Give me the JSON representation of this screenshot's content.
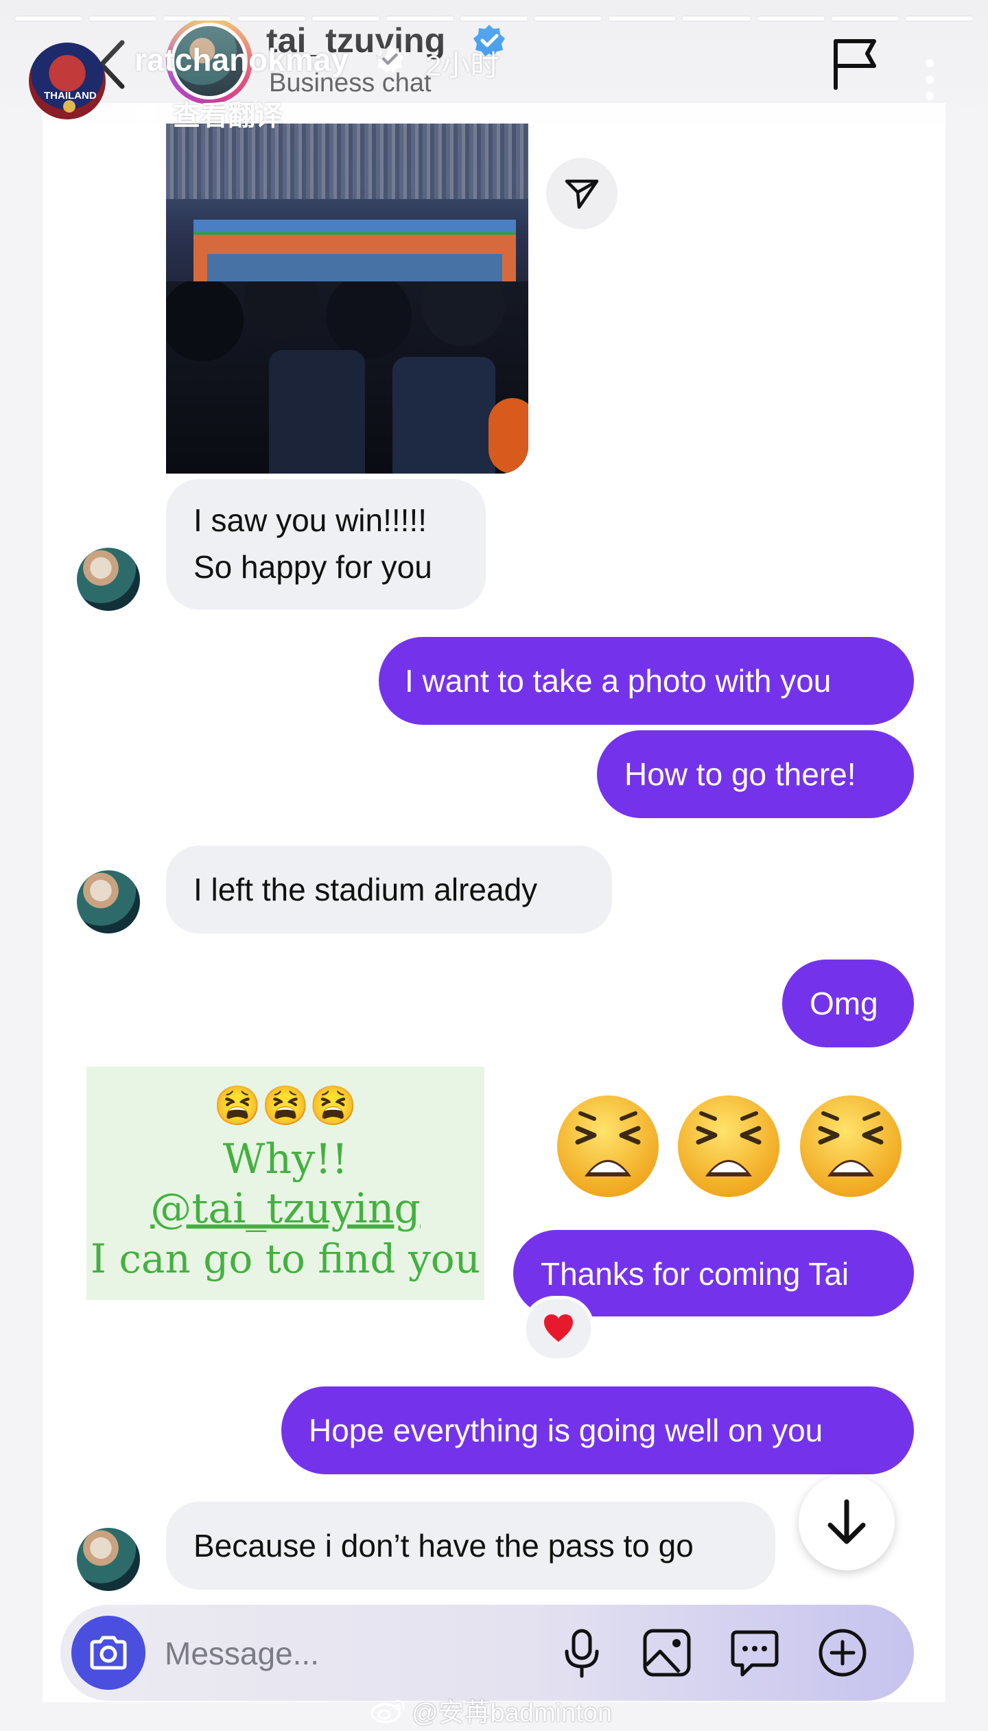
{
  "story": {
    "username": "ratchanokmay",
    "time_ago": "2小时",
    "translate_label": "查看翻译",
    "avatar_caption": "THAILAND",
    "progress_segments": 13
  },
  "chat_header": {
    "name": "tai_tzuying",
    "subtitle": "Business chat"
  },
  "messages": [
    {
      "side": "in",
      "lines": "I saw you win!!!!!\nSo happy for you"
    },
    {
      "side": "out",
      "lines": "I want to take a photo with you"
    },
    {
      "side": "out",
      "lines": "How to go there!"
    },
    {
      "side": "in",
      "lines": "I left the stadium already"
    },
    {
      "side": "out",
      "lines": "Omg"
    },
    {
      "side": "out",
      "lines": "Thanks for coming Tai"
    },
    {
      "side": "out",
      "lines": "Hope everything is going well on you"
    },
    {
      "side": "in",
      "lines": "Because i don’t have the pass to go"
    }
  ],
  "sticker": {
    "emojis": "😫😫😫",
    "line1": "Why!!",
    "line2": "@tai_tzuying",
    "line3": "I can go to find you"
  },
  "reaction": "heart",
  "composer": {
    "placeholder": "Message..."
  },
  "watermark": "@安苒badminton",
  "colors": {
    "outgoing_bubble": "#7433eb",
    "incoming_bubble": "#eff0f3",
    "camera_button": "#4a4fe0",
    "sticker_text": "#44b040",
    "verified": "#1d8cf0"
  },
  "icons": [
    "flag-icon",
    "more-icon",
    "back-icon",
    "verified-icon",
    "send-icon",
    "heart-icon",
    "arrow-down-icon",
    "camera-icon",
    "microphone-icon",
    "gallery-icon",
    "sticker-icon",
    "plus-icon",
    "weibo-icon"
  ]
}
